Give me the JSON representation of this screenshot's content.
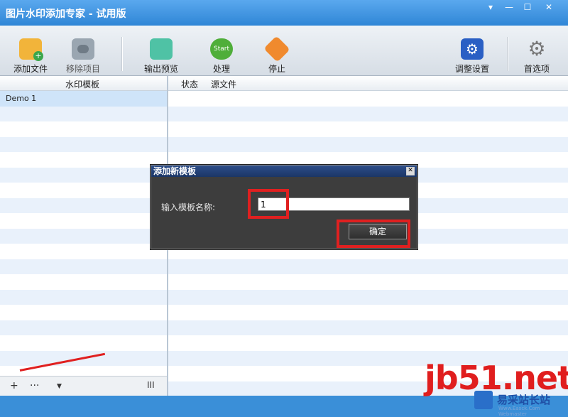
{
  "window": {
    "title": "图片水印添加专家 - 试用版"
  },
  "toolbar": {
    "add_file": "添加文件",
    "remove_item": "移除项目",
    "output_preview": "输出预览",
    "process": "处理",
    "stop": "停止",
    "settings": "调整设置",
    "preferences": "首选项"
  },
  "left_panel": {
    "header": "水印模板",
    "items": [
      "Demo 1"
    ]
  },
  "right_panel": {
    "columns": [
      "状态",
      "源文件"
    ]
  },
  "dialog": {
    "title": "添加新模板",
    "label": "输入模板名称:",
    "input_value": "1",
    "ok_label": "确定"
  },
  "footer": {
    "add": "+",
    "more": "···",
    "cols": "III"
  },
  "watermark": {
    "brand": "jb51.net",
    "site": "易采站长站",
    "sub": "Www.Easck.Com Webmaster"
  },
  "colors": {
    "highlight": "#e02020",
    "accent": "#3a8fd8"
  }
}
